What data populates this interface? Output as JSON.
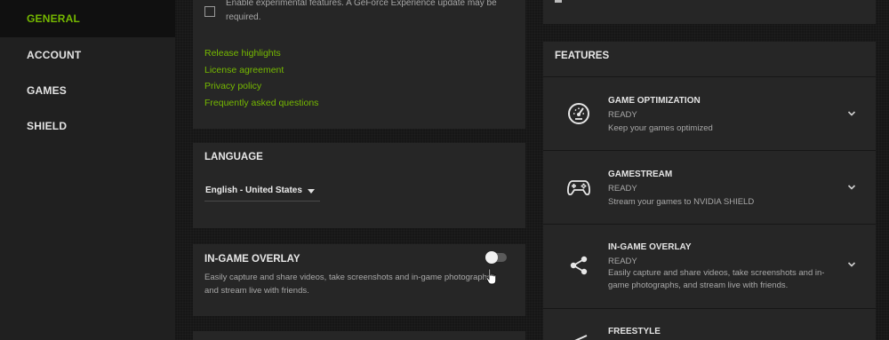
{
  "sidebar": {
    "items": [
      {
        "label": "GENERAL",
        "active": true
      },
      {
        "label": "ACCOUNT",
        "active": false
      },
      {
        "label": "GAMES",
        "active": false
      },
      {
        "label": "SHIELD",
        "active": false
      }
    ]
  },
  "about": {
    "experimental_label": "Enable experimental features. A GeForce Experience update may be required.",
    "links": [
      "Release highlights",
      "License agreement",
      "Privacy policy",
      "Frequently asked questions"
    ]
  },
  "language": {
    "title": "LANGUAGE",
    "selected": "English - United States"
  },
  "overlay": {
    "title": "IN-GAME OVERLAY",
    "description": "Easily capture and share videos, take screenshots and in-game photographs, and stream live with friends.",
    "enabled": false
  },
  "features": {
    "title": "FEATURES",
    "items": [
      {
        "name": "GAME OPTIMIZATION",
        "status": "READY",
        "description": "Keep your games optimized",
        "icon": "speedometer-icon"
      },
      {
        "name": "GAMESTREAM",
        "status": "READY",
        "description": "Stream your games to NVIDIA SHIELD",
        "icon": "gamepad-icon"
      },
      {
        "name": "IN-GAME OVERLAY",
        "status": "READY",
        "description": "Easily capture and share videos, take screenshots and in-game photographs, and stream live with friends.",
        "icon": "share-icon"
      },
      {
        "name": "FREESTYLE",
        "status": "",
        "description": "",
        "icon": "freestyle-icon"
      }
    ]
  },
  "colors": {
    "accent": "#76b900",
    "panel": "#262626",
    "sidebar": "#202020"
  }
}
